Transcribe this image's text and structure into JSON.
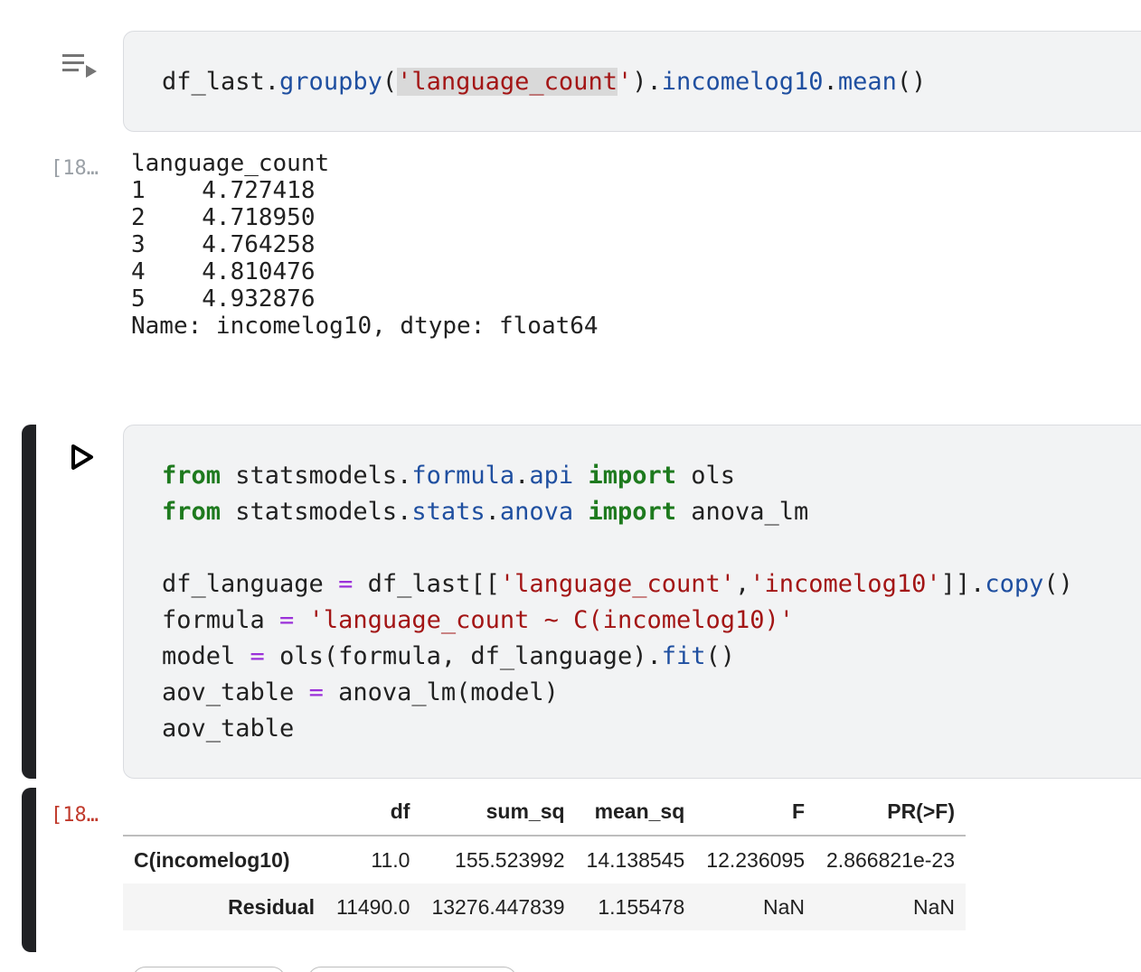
{
  "cell1": {
    "exec_count": "[18…",
    "code": {
      "t1": "df_last.",
      "t2": "groupby",
      "t3": "(",
      "t4": "'",
      "t5": "language_count",
      "t6": "'",
      "t7": ").",
      "t8": "incomelog10",
      "t9": ".",
      "t10": "mean",
      "t11": "()"
    },
    "output": "language_count\n1    4.727418\n2    4.718950\n3    4.764258\n4    4.810476\n5    4.932876\nName: incomelog10, dtype: float64"
  },
  "cell2": {
    "exec_count": "[18…",
    "lines": {
      "l1": {
        "a": "from",
        "b": " statsmodels.",
        "c": "formula",
        "d": ".",
        "e": "api",
        "f": " ",
        "g": "import",
        "h": " ols"
      },
      "l2": {
        "a": "from",
        "b": " statsmodels.",
        "c": "stats",
        "d": ".",
        "e": "anova",
        "f": " ",
        "g": "import",
        "h": " anova_lm"
      },
      "l4": {
        "a": "df_language ",
        "b": "=",
        "c": " df_last[[",
        "d": "'language_count'",
        "e": ",",
        "f": "'incomelog10'",
        "g": "]].",
        "h": "copy",
        "i": "()"
      },
      "l5": {
        "a": "formula ",
        "b": "=",
        "c": " ",
        "d": "'language_count ~ C(incomelog10)'"
      },
      "l6": {
        "a": "model ",
        "b": "=",
        "c": " ols(formula, df_language).",
        "d": "fit",
        "e": "()"
      },
      "l7": {
        "a": "aov_table ",
        "b": "=",
        "c": " anova_lm(model)"
      },
      "l8": {
        "a": "aov_table"
      }
    },
    "table": {
      "columns": [
        "",
        "df",
        "sum_sq",
        "mean_sq",
        "F",
        "PR(>F)"
      ],
      "rows": [
        {
          "index": "C(incomelog10)",
          "df": "11.0",
          "sum_sq": "155.523992",
          "mean_sq": "14.138545",
          "F": "12.236095",
          "pr": "2.866821e-23"
        },
        {
          "index": "Residual",
          "df": "11490.0",
          "sum_sq": "13276.447839",
          "mean_sq": "1.155478",
          "F": "NaN",
          "pr": "NaN"
        }
      ]
    }
  },
  "icons": {
    "output_menu": "output-menu-icon",
    "run": "run-cell-icon"
  },
  "colors": {
    "function": "#1f4fa0",
    "string": "#a31515",
    "keyword": "#1e7a1e",
    "operator": "#9b30d9",
    "cell_bg": "#f2f3f4",
    "focus_bar": "#202124"
  }
}
